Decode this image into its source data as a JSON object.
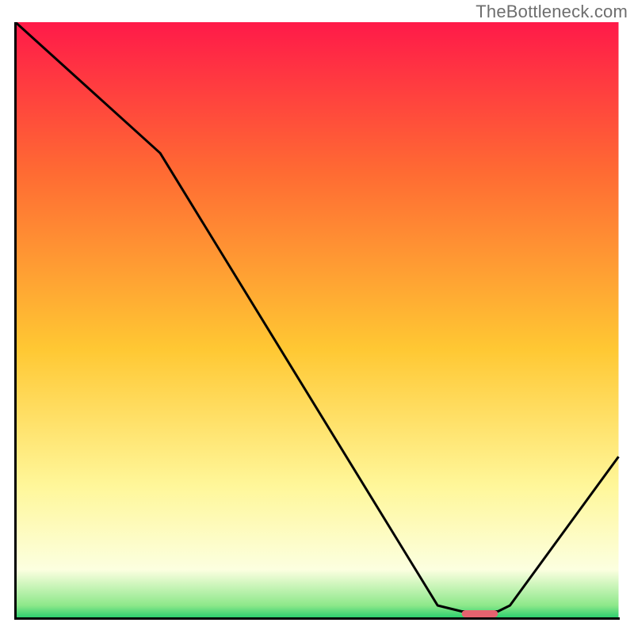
{
  "watermark": "TheBottleneck.com",
  "chart_data": {
    "type": "line",
    "title": "",
    "xlabel": "",
    "ylabel": "",
    "xlim": [
      0,
      100
    ],
    "ylim": [
      0,
      100
    ],
    "gradient_stops": [
      {
        "offset": 0,
        "color": "#ff1a49"
      },
      {
        "offset": 25,
        "color": "#ff6a33"
      },
      {
        "offset": 55,
        "color": "#ffc833"
      },
      {
        "offset": 78,
        "color": "#fff79a"
      },
      {
        "offset": 92,
        "color": "#fcffe0"
      },
      {
        "offset": 98,
        "color": "#8de88a"
      },
      {
        "offset": 100,
        "color": "#2ecf6f"
      }
    ],
    "series": [
      {
        "name": "bottleneck-curve",
        "color": "#000000",
        "x": [
          0,
          24,
          70,
          74,
          80,
          82,
          100
        ],
        "y": [
          100,
          78,
          2,
          1,
          1,
          2,
          27
        ]
      }
    ],
    "marker": {
      "name": "optimal-range",
      "color": "#e6636f",
      "x_start": 74,
      "x_end": 80,
      "y": 0.6,
      "thickness": 1.2
    },
    "axis": {
      "color": "#000000",
      "line_width": 3
    }
  }
}
